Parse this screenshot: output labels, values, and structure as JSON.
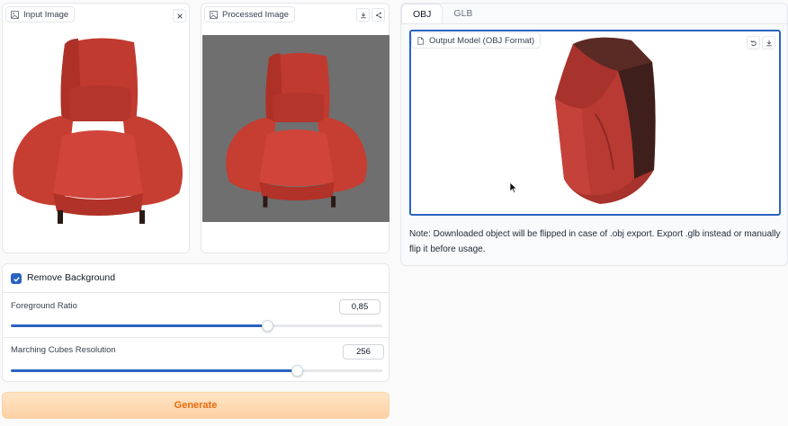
{
  "input_panel": {
    "label": "Input Image",
    "icon": "image-icon",
    "close_icon": "close-icon"
  },
  "processed_panel": {
    "label": "Processed Image",
    "icon": "image-icon",
    "download_icon": "download-icon",
    "share_icon": "share-icon"
  },
  "tabs": [
    {
      "label": "OBJ",
      "active": true
    },
    {
      "label": "GLB",
      "active": false
    }
  ],
  "model_viewer": {
    "label": "Output Model (OBJ Format)",
    "icon": "file-icon",
    "reset_icon": "undo-icon",
    "download_icon": "download-icon"
  },
  "note": "Note: Downloaded object will be flipped in case of .obj export. Export .glb instead or manually flip it before usage.",
  "controls": {
    "remove_background": {
      "label": "Remove Background",
      "checked": true
    },
    "foreground_ratio": {
      "label": "Foreground Ratio",
      "value": "0,85",
      "fraction": 0.69
    },
    "mc_resolution": {
      "label": "Marching Cubes Resolution",
      "value": "256",
      "fraction": 0.77
    }
  },
  "generate_label": "Generate",
  "colors": {
    "accent": "#2a63c1",
    "generate_text": "#ea6a0c",
    "generate_bg": "#fdd1a2",
    "chair_red": "#c8392e"
  }
}
